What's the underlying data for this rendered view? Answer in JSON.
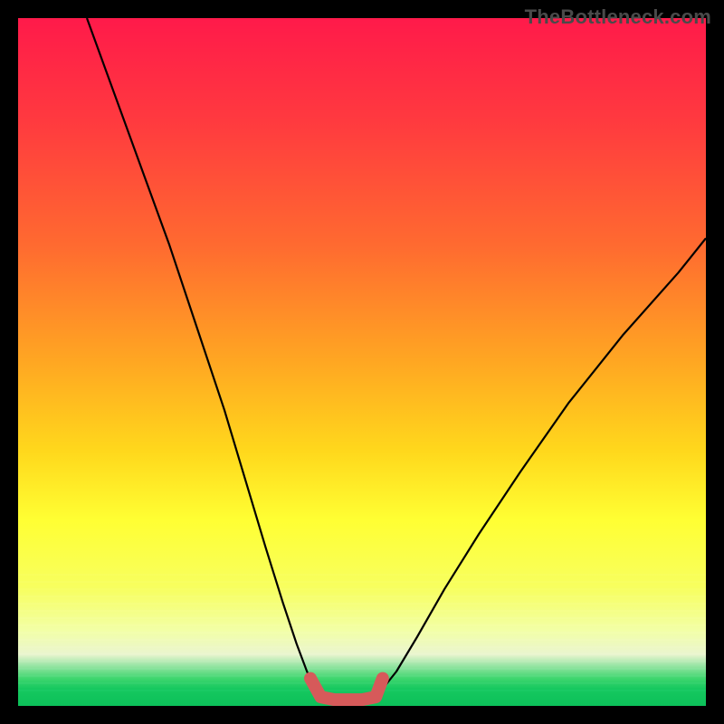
{
  "watermark": "TheBottleneck.com",
  "chart_data": {
    "type": "line",
    "title": "",
    "xlabel": "",
    "ylabel": "",
    "xlim": [
      0,
      100
    ],
    "ylim": [
      0,
      100
    ],
    "grid": false,
    "legend": false,
    "background": {
      "kind": "vertical-gradient",
      "stops": [
        {
          "pos": 0.0,
          "color": "#ff1a4a"
        },
        {
          "pos": 0.15,
          "color": "#ff3a3f"
        },
        {
          "pos": 0.33,
          "color": "#ff6a30"
        },
        {
          "pos": 0.5,
          "color": "#ffa722"
        },
        {
          "pos": 0.63,
          "color": "#ffd81c"
        },
        {
          "pos": 0.73,
          "color": "#ffff33"
        },
        {
          "pos": 0.83,
          "color": "#f7ff60"
        },
        {
          "pos": 0.89,
          "color": "#f2ffa6"
        },
        {
          "pos": 0.93,
          "color": "#eaf5cf"
        },
        {
          "pos": 0.94,
          "color": "#9fe6a8"
        },
        {
          "pos": 0.96,
          "color": "#3fd66e"
        },
        {
          "pos": 0.98,
          "color": "#16c85f"
        },
        {
          "pos": 1.0,
          "color": "#0cc059"
        }
      ]
    },
    "series": [
      {
        "name": "left-branch",
        "color": "#000000",
        "width": 2.2,
        "x": [
          10,
          14,
          18,
          22,
          26,
          30,
          33,
          36,
          38.5,
          40.5,
          42,
          43.2,
          44
        ],
        "y": [
          100,
          89,
          78,
          67,
          55,
          43,
          33,
          23,
          15,
          9,
          5,
          2.5,
          1.2
        ]
      },
      {
        "name": "right-branch",
        "color": "#000000",
        "width": 2.2,
        "x": [
          52,
          53,
          55,
          58,
          62,
          67,
          73,
          80,
          88,
          96,
          100
        ],
        "y": [
          1.2,
          2.5,
          5,
          10,
          17,
          25,
          34,
          44,
          54,
          63,
          68
        ]
      },
      {
        "name": "bottom-highlight",
        "color": "#d65a5a",
        "width": 14,
        "linecap": "round",
        "x": [
          42.5,
          44.0,
          46.0,
          48.0,
          50.0,
          52.0,
          53.0
        ],
        "y": [
          4.0,
          1.3,
          0.9,
          0.9,
          0.9,
          1.3,
          4.0
        ]
      }
    ]
  }
}
